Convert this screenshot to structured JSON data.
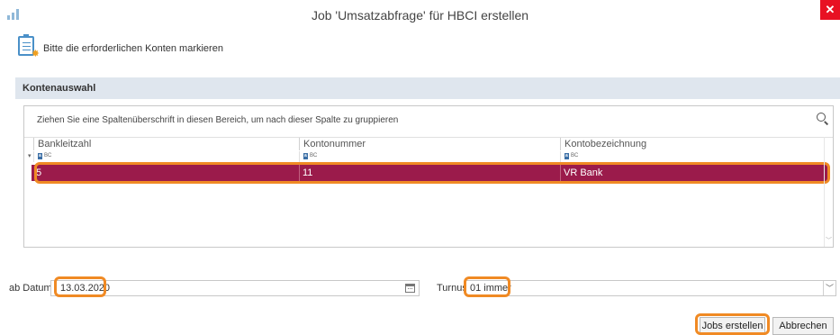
{
  "window": {
    "title": "Job 'Umsatzabfrage' für HBCI erstellen",
    "close_glyph": "✕"
  },
  "header": {
    "instruction": "Bitte die erforderlichen Konten markieren",
    "icon": "clipboard-star-icon"
  },
  "section": {
    "title": "Kontenauswahl"
  },
  "grid": {
    "group_hint": "Ziehen Sie eine Spaltenüberschrift in diesen Bereich, um nach dieser Spalte zu gruppieren",
    "columns": [
      "Bankleitzahl",
      "Kontonummer",
      "Kontobezeichnung"
    ],
    "filter_badge": "a",
    "filter_badge_rest": "BC",
    "rows": [
      {
        "bankleitzahl": "5",
        "kontonummer": "11",
        "kontobezeichnung": "VR Bank"
      }
    ],
    "selected_row_color": "#9b1b4b"
  },
  "form": {
    "date_label": "ab Datum",
    "date_value": "13.03.2020",
    "turnus_label": "Turnus",
    "turnus_value": "01 immer"
  },
  "buttons": {
    "create": "Jobs erstellen",
    "cancel": "Abbrechen"
  },
  "colors": {
    "highlight": "#f08a24",
    "section_bar": "#dfe6ee",
    "close": "#e81123"
  }
}
